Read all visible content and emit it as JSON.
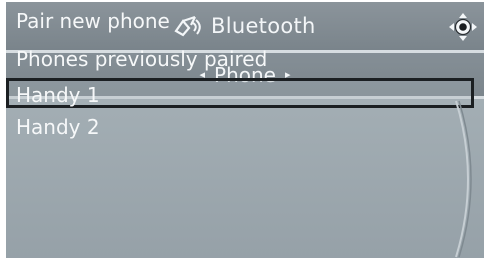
{
  "header": {
    "title": "Bluetooth",
    "bluetooth_icon": "bluetooth-icon",
    "controller_icon": "controller-icon"
  },
  "subheader": {
    "label": "Phone",
    "left_arrow": "◂",
    "right_arrow": "▸"
  },
  "menu": {
    "items": [
      {
        "label": "Pair new phone"
      },
      {
        "label": "Phones previously paired"
      },
      {
        "label": "Handy 1",
        "selected": true
      },
      {
        "label": "Handy 2"
      }
    ]
  },
  "colors": {
    "title_bar": "#7f8990",
    "list_background": "#9ea9af",
    "text": "#f6f8f9",
    "selection_border": "#1b1f22"
  }
}
